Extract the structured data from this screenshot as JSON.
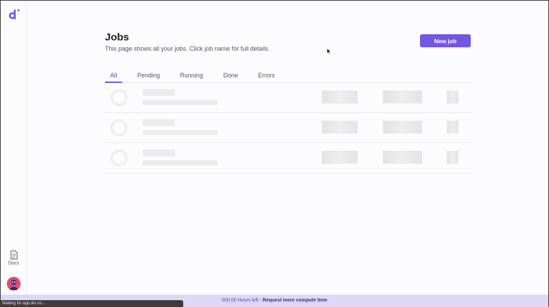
{
  "sidebar": {
    "docs_label": "Docs"
  },
  "header": {
    "title": "Jobs",
    "subtitle": "This page shows all your jobs. Click job name for full details.",
    "new_job_label": "New job"
  },
  "tabs": [
    {
      "label": "All",
      "active": true
    },
    {
      "label": "Pending",
      "active": false
    },
    {
      "label": "Running",
      "active": false
    },
    {
      "label": "Done",
      "active": false
    },
    {
      "label": "Errors",
      "active": false
    }
  ],
  "jobs_table": {
    "loading": true,
    "skeleton_rows": 3
  },
  "banner": {
    "hours_text": "500.00 Hours left",
    "separator": " - ",
    "link_text": "Request more compute time"
  },
  "browser_status": "Waiting for app.dis.co...",
  "icons": {
    "logo": "brand-logo-icon",
    "docs": "document-icon",
    "avatar": "user-avatar",
    "cursor": "mouse-pointer-icon"
  },
  "colors": {
    "accent": "#7556e0",
    "banner_bg": "#dcd8f6",
    "skeleton": "#ececec"
  }
}
